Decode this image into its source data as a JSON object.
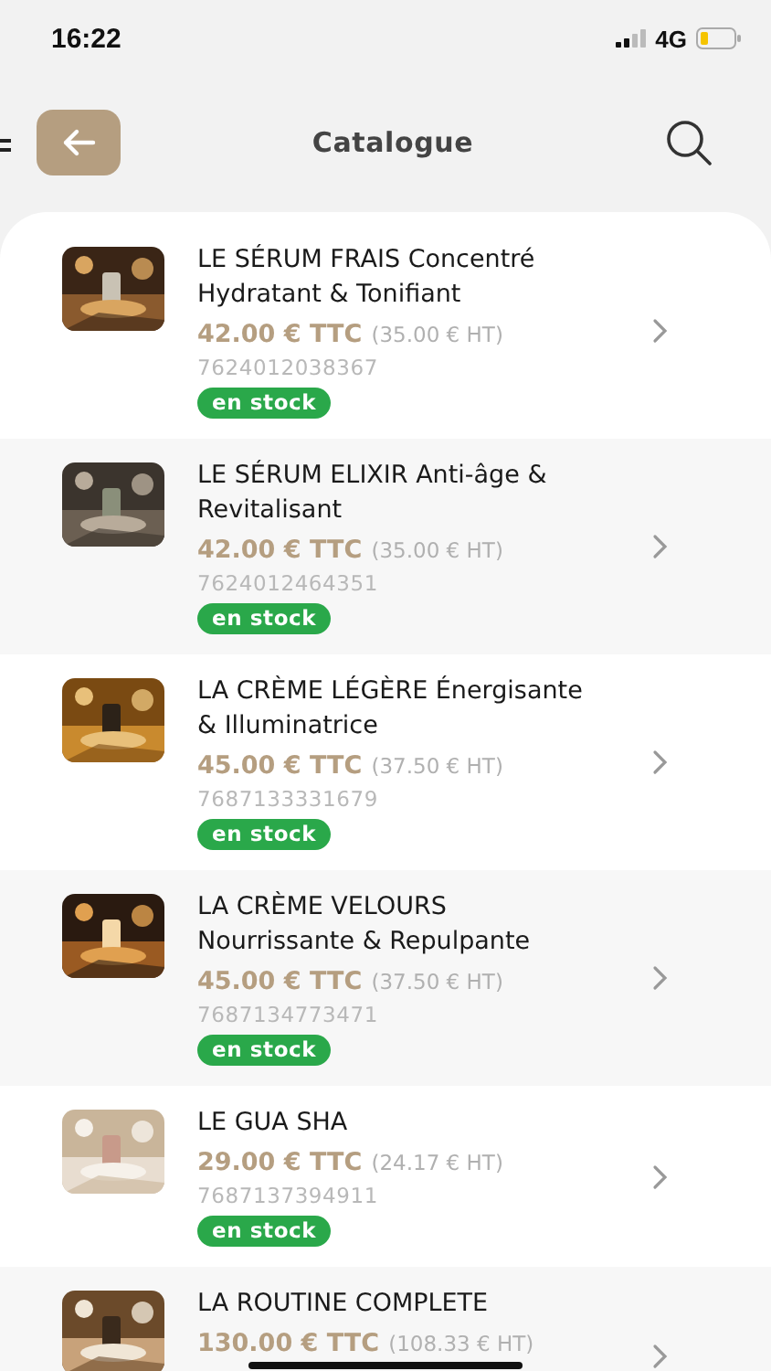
{
  "status_bar": {
    "time": "16:22",
    "network": "4G"
  },
  "header": {
    "title": "Catalogue"
  },
  "products": [
    {
      "name": "LE SÉRUM FRAIS Concentré Hydratant & Tonifiant",
      "price_ttc": "42.00 € TTC",
      "price_ht": "(35.00 € HT)",
      "barcode": "7624012038367",
      "stock": "en stock"
    },
    {
      "name": "LE SÉRUM ELIXIR Anti-âge & Revitalisant",
      "price_ttc": "42.00 € TTC",
      "price_ht": "(35.00 € HT)",
      "barcode": "7624012464351",
      "stock": "en stock"
    },
    {
      "name": "LA CRÈME LÉGÈRE Énergisante & Illuminatrice",
      "price_ttc": "45.00 € TTC",
      "price_ht": "(37.50 € HT)",
      "barcode": "7687133331679",
      "stock": "en stock"
    },
    {
      "name": "LA CRÈME VELOURS Nourrissante & Repulpante",
      "price_ttc": "45.00 € TTC",
      "price_ht": "(37.50 € HT)",
      "barcode": "7687134773471",
      "stock": "en stock"
    },
    {
      "name": "LE GUA SHA",
      "price_ttc": "29.00 € TTC",
      "price_ht": "(24.17 € HT)",
      "barcode": "7687137394911",
      "stock": "en stock"
    },
    {
      "name": "LA ROUTINE COMPLETE",
      "price_ttc": "130.00 € TTC",
      "price_ht": "(108.33 € HT)"
    }
  ]
}
